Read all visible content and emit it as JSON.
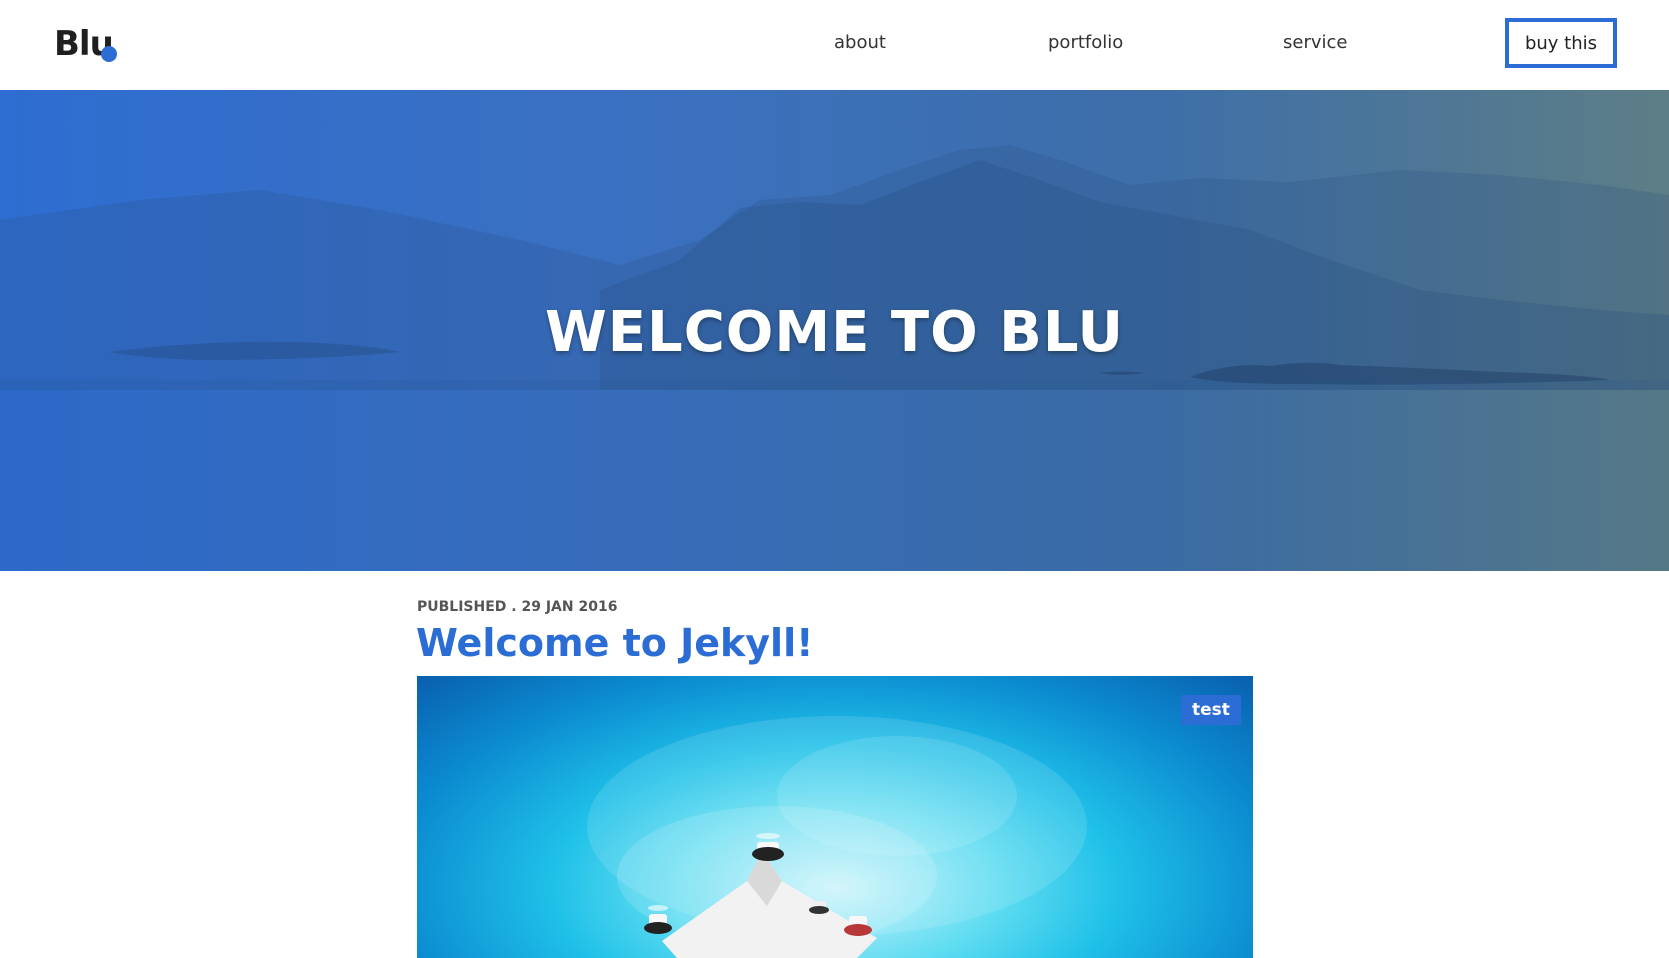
{
  "header": {
    "logo_text": "Blu",
    "nav": [
      {
        "label": "about"
      },
      {
        "label": "portfolio"
      },
      {
        "label": "service"
      }
    ],
    "buy_label": "buy this"
  },
  "hero": {
    "title": "WELCOME TO BLU"
  },
  "post": {
    "meta": "PUBLISHED . 29 JAN 2016",
    "title": "Welcome to Jekyll!",
    "tag": "test"
  },
  "colors": {
    "accent": "#2b6dd4",
    "text": "#333333"
  }
}
